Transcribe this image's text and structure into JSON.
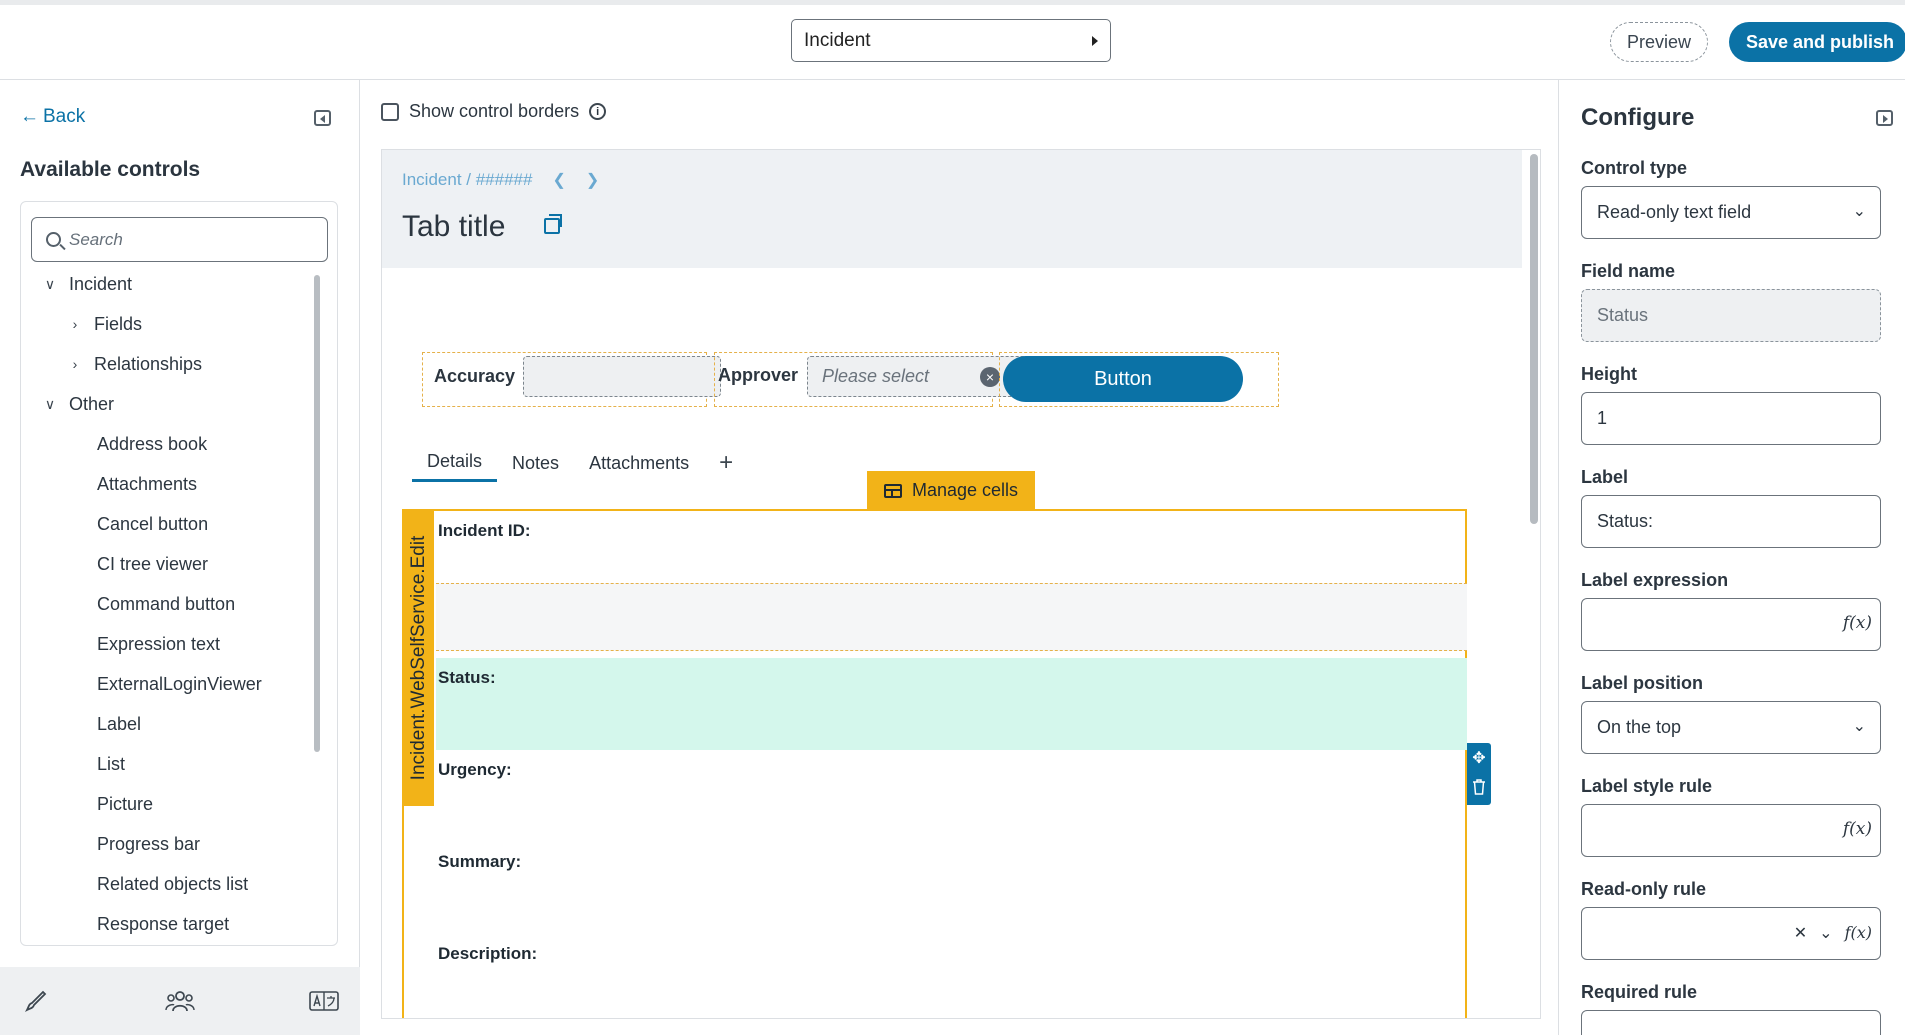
{
  "header": {
    "object_selector": "Incident",
    "preview_label": "Preview",
    "publish_label": "Save and publish"
  },
  "left_panel": {
    "back_label": "Back",
    "title": "Available controls",
    "search_placeholder": "Search",
    "tree": [
      {
        "label": "Incident",
        "level": 0,
        "expanded": true
      },
      {
        "label": "Fields",
        "level": 1,
        "expanded": false
      },
      {
        "label": "Relationships",
        "level": 1,
        "expanded": false
      },
      {
        "label": "Other",
        "level": 0,
        "expanded": true
      },
      {
        "label": "Address book",
        "level": 2
      },
      {
        "label": "Attachments",
        "level": 2
      },
      {
        "label": "Cancel button",
        "level": 2
      },
      {
        "label": "CI tree viewer",
        "level": 2
      },
      {
        "label": "Command button",
        "level": 2
      },
      {
        "label": "Expression text",
        "level": 2
      },
      {
        "label": "ExternalLoginViewer",
        "level": 2
      },
      {
        "label": "Label",
        "level": 2
      },
      {
        "label": "List",
        "level": 2
      },
      {
        "label": "Picture",
        "level": 2
      },
      {
        "label": "Progress bar",
        "level": 2
      },
      {
        "label": "Related objects list",
        "level": 2
      },
      {
        "label": "Response target",
        "level": 2
      }
    ],
    "footer_icons": [
      "brush-icon",
      "users-icon",
      "translate-icon"
    ]
  },
  "center": {
    "show_borders_label": "Show control borders",
    "breadcrumb": "Incident / ######",
    "tab_title": "Tab title",
    "accuracy_label": "Accuracy",
    "approver_label": "Approver",
    "approver_placeholder": "Please select",
    "button_label": "Button",
    "tabs": [
      "Details",
      "Notes",
      "Attachments"
    ],
    "active_tab": "Details",
    "add_tab_symbol": "+",
    "manage_cells_label": "Manage cells",
    "layout_name": "Incident.WebSelfService.Edit",
    "cells": [
      "Incident ID:",
      "",
      "Status:",
      "Urgency:",
      "Summary:",
      "Description:"
    ],
    "selected_cell": "Status:"
  },
  "right_panel": {
    "title": "Configure",
    "control_type_label": "Control type",
    "control_type_value": "Read-only text field",
    "field_name_label": "Field name",
    "field_name_value": "Status",
    "height_label": "Height",
    "height_value": "1",
    "label_label": "Label",
    "label_value": "Status:",
    "label_expression_label": "Label expression",
    "label_position_label": "Label position",
    "label_position_value": "On the top",
    "label_style_rule_label": "Label style rule",
    "readonly_rule_label": "Read-only rule",
    "required_rule_label": "Required rule",
    "fx_symbol": "f(x)"
  },
  "colors": {
    "primary": "#0b72a6",
    "accent_yellow": "#f2b318",
    "selected_cell": "#d4f7ec"
  }
}
